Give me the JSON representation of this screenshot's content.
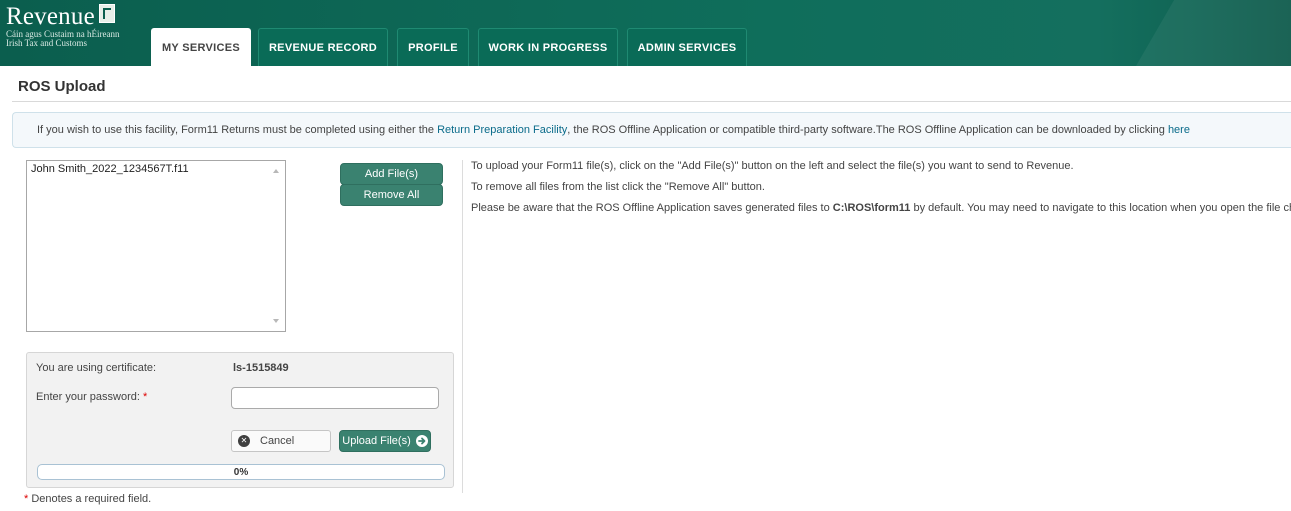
{
  "brand": {
    "name": "Revenue",
    "subtitle_irish": "Cáin agus Custaim na hÉireann",
    "subtitle_english": "Irish Tax and Customs",
    "header_color": "#0b5e4e",
    "accent_red": "#e02020"
  },
  "nav": {
    "tabs": [
      {
        "label": "MY SERVICES",
        "active": true
      },
      {
        "label": "REVENUE RECORD",
        "active": false
      },
      {
        "label": "PROFILE",
        "active": false
      },
      {
        "label": "WORK IN PROGRESS",
        "active": false
      },
      {
        "label": "ADMIN SERVICES",
        "active": false
      }
    ]
  },
  "page": {
    "title": "ROS Upload"
  },
  "info": {
    "text_before": "If you wish to use this facility, Form11 Returns must be completed using either the ",
    "link1": "Return Preparation Facility",
    "text_middle": ", the ROS Offline Application or compatible third-party software.The ROS Offline Application can be downloaded by clicking ",
    "link2": "here"
  },
  "files": {
    "items": [
      "John Smith_2022_1234567T.f11"
    ],
    "add_label": "Add File(s)",
    "remove_all_label": "Remove All"
  },
  "instructions": {
    "line1": "To upload your Form11 file(s), click on the \"Add File(s)\" button on the left and select the file(s) you want to send to Revenue.",
    "line2": "To remove all files from the list click the \"Remove All\" button.",
    "line3_before": "Please be aware that the ROS Offline Application saves generated files to ",
    "line3_path": "C:\\ROS\\form11",
    "line3_after": " by default. You may need to navigate to this location when you open the file chooser."
  },
  "certificate": {
    "label": "You are using certificate:",
    "value": "ls-1515849",
    "password_label": "Enter your password:",
    "required_marker": "*",
    "password_value": "",
    "cancel_label": "Cancel",
    "upload_label": "Upload File(s)",
    "progress_percent": 0,
    "progress_text": "0%"
  },
  "footnote": {
    "marker": "*",
    "text": " Denotes a required field."
  },
  "icons": {
    "cancel": "x-circle-icon",
    "upload": "arrow-right-icon",
    "scroll_up": "scroll-up-arrow-icon",
    "scroll_down": "scroll-down-arrow-icon"
  }
}
